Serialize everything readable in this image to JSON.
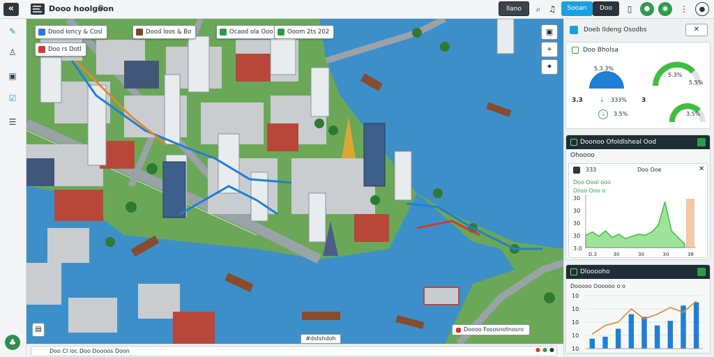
{
  "topbar": {
    "back_icon": "chevrons-left-icon",
    "title": "Dooo hoolgoon",
    "title_icon": "settings-icon",
    "mode_button": "llano",
    "tab_active": "Sooan",
    "tab_inactive": "Doo",
    "accent": "#1aa0e0"
  },
  "rail": {
    "icons": [
      "map-pin-icon",
      "user-icon",
      "image-icon",
      "checklist-icon",
      "list-icon"
    ]
  },
  "map": {
    "pins": [
      {
        "label": "Dood Ioncy & Cosl",
        "color": "#2a7bd6"
      },
      {
        "label": "Dood loos & Bo",
        "color": "#7a4a2a"
      },
      {
        "label": "Ocaod ola Ooo",
        "color": "#2c9c4b"
      },
      {
        "label": "Ooom 2ts 202",
        "color": "#2c9c4b"
      },
      {
        "label": "Doo rs Dotl",
        "color": "#d23a2e"
      }
    ],
    "corner_icon": "layers-icon",
    "bottom_label": "#dstshdoh",
    "legend_text": "Doooo Fososnotnosro",
    "tools": [
      "image-icon",
      "crosshair-icon",
      "compass-icon"
    ]
  },
  "statusbar": {
    "text": "Doo Cl loc Doo Doooos Doon"
  },
  "panel": {
    "header_title": "Doeb Ildeng Osodbs",
    "summary": {
      "title": "Doo Bholsa",
      "gauge1_value": "5.3.3%",
      "gauge2_value": "5.3%",
      "gauge2_sub": "5.5%",
      "row2_left": "3.3",
      "row2_mid": "333%",
      "gauge3_value": "3.5%",
      "row2_right_left": "3",
      "gauge4_value": "3.5%"
    },
    "detail": {
      "header": "Doonoo Ofoldlsheal Ood",
      "subheader": "Ohoooo",
      "card_left": "333",
      "card_title": "Doo Ooe",
      "row1_label": "Doo Oool ooo",
      "row2_label": "Ooso Ooo o",
      "chart_data": {
        "type": "area",
        "y_ticks": [
          "3.0",
          "30",
          "30",
          "30",
          "30"
        ],
        "x_ticks": [
          "D.3",
          "30",
          "30",
          "30",
          "38"
        ],
        "series": [
          {
            "values": [
              22,
              28,
              20,
              30,
              18,
              24,
              16,
              20,
              24,
              22,
              28,
              40,
              82,
              30,
              18,
              6
            ]
          }
        ],
        "color": "#3fbf3f"
      }
    },
    "chart2": {
      "header": "Dlooooho",
      "row_label": "Dooooo Oooooo o o",
      "chart_data": {
        "type": "bar",
        "y_ticks": [
          "10",
          "10",
          "10",
          "10",
          "10"
        ],
        "categories": [
          "",
          "",
          "",
          "",
          "",
          "",
          "",
          "",
          ""
        ],
        "series": [
          {
            "values": [
              15,
              18,
              30,
              52,
              48,
              35,
              42,
              65,
              70
            ]
          },
          {
            "values": [
              22,
              35,
              40,
              60,
              45,
              52,
              62,
              55,
              72
            ]
          }
        ],
        "bar_color": "#1f7fd4",
        "line_color": "#e08a2a"
      }
    }
  }
}
